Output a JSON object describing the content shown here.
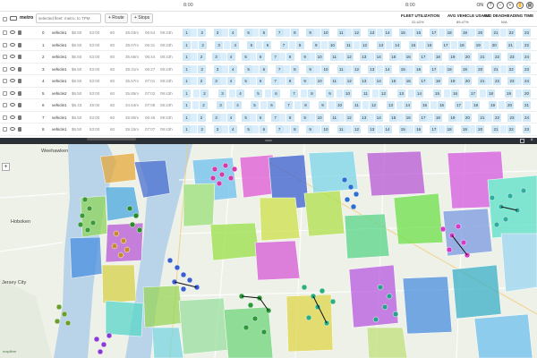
{
  "timeline": {
    "labels": [
      "8:00",
      "8:00",
      "8:00"
    ],
    "on_label": "ON"
  },
  "toolbar": {
    "name": "metro",
    "search_placeholder": "selected fleet: metro, to TPM",
    "route_button": "+ Route",
    "stops_button": "+ Stops",
    "stats": [
      {
        "title": "FLEET UTILIZATION",
        "value": "22.42%"
      },
      {
        "title": "AVG VEHICLE USAGE",
        "value": "89.47%"
      },
      {
        "title": "AVG DEADHEADING TIME",
        "value": "N/A"
      }
    ]
  },
  "rows": [
    {
      "index": "0",
      "vehicle": "vehicle1",
      "rate": "$6.50",
      "start": "53:00",
      "cap": "60",
      "dist": "38.03m",
      "time": "06:54",
      "end": "09:43h",
      "stops": [
        "1",
        "2",
        "3",
        "4",
        "5",
        "6",
        "7",
        "8",
        "9",
        "10",
        "11",
        "12",
        "13",
        "14",
        "15",
        "16",
        "17",
        "18",
        "19",
        "20",
        "21",
        "22",
        "23"
      ]
    },
    {
      "index": "1",
      "vehicle": "vehicle1",
      "rate": "$6.50",
      "start": "53:00",
      "cap": "60",
      "dist": "39.07m",
      "time": "06:31",
      "end": "08:43h",
      "stops": [
        "1",
        "2",
        "3",
        "4",
        "5",
        "6",
        "7",
        "8",
        "9",
        "10",
        "11",
        "12",
        "13",
        "14",
        "15",
        "16",
        "17",
        "18",
        "19",
        "20",
        "21",
        "22"
      ]
    },
    {
      "index": "2",
      "vehicle": "vehicle1",
      "rate": "$6.50",
      "start": "53:00",
      "cap": "60",
      "dist": "35.66m",
      "time": "06:44",
      "end": "08:43h",
      "stops": [
        "1",
        "2",
        "3",
        "4",
        "5",
        "6",
        "7",
        "8",
        "9",
        "10",
        "11",
        "12",
        "13",
        "14",
        "15",
        "16",
        "17",
        "18",
        "19",
        "20",
        "21",
        "22",
        "23",
        "24"
      ]
    },
    {
      "index": "3",
      "vehicle": "vehicle1",
      "rate": "$6.50",
      "start": "53:00",
      "cap": "60",
      "dist": "39.31m",
      "time": "06:27",
      "end": "09:43h",
      "stops": [
        "1",
        "2",
        "3",
        "4",
        "5",
        "6",
        "7",
        "8",
        "9",
        "10",
        "11",
        "12",
        "13",
        "14",
        "15",
        "16",
        "17",
        "18",
        "19",
        "20",
        "21",
        "22",
        "23"
      ]
    },
    {
      "index": "4",
      "vehicle": "vehicle1",
      "rate": "$6.50",
      "start": "53:00",
      "cap": "60",
      "dist": "35.67m",
      "time": "07:01",
      "end": "09:43h",
      "stops": [
        "1",
        "2",
        "3",
        "4",
        "5",
        "6",
        "7",
        "8",
        "9",
        "10",
        "11",
        "12",
        "13",
        "14",
        "15",
        "16",
        "17",
        "18",
        "19",
        "20",
        "21",
        "22",
        "23",
        "24"
      ]
    },
    {
      "index": "5",
      "vehicle": "vehicle2",
      "rate": "$6.50",
      "start": "53:00",
      "cap": "60",
      "dist": "35.85m",
      "time": "07:02",
      "end": "09:43h",
      "stops": [
        "1",
        "2",
        "3",
        "4",
        "5",
        "6",
        "7",
        "8",
        "9",
        "10",
        "11",
        "12",
        "13",
        "14",
        "15",
        "16",
        "17",
        "18",
        "19",
        "20"
      ]
    },
    {
      "index": "6",
      "vehicle": "vehicle1",
      "rate": "$6.43",
      "start": "49:00",
      "cap": "60",
      "dist": "34.54m",
      "time": "07:08",
      "end": "08:43h",
      "stops": [
        "1",
        "2",
        "3",
        "4",
        "5",
        "6",
        "7",
        "8",
        "9",
        "10",
        "11",
        "12",
        "13",
        "14",
        "15",
        "16",
        "17",
        "18",
        "19",
        "20",
        "21"
      ]
    },
    {
      "index": "7",
      "vehicle": "vehicle1",
      "rate": "$6.50",
      "start": "53:00",
      "cap": "60",
      "dist": "38.90m",
      "time": "06:46",
      "end": "09:43h",
      "stops": [
        "1",
        "2",
        "3",
        "4",
        "5",
        "6",
        "7",
        "8",
        "9",
        "10",
        "11",
        "12",
        "13",
        "14",
        "15",
        "16",
        "17",
        "18",
        "19",
        "20",
        "21",
        "22",
        "23",
        "24"
      ]
    },
    {
      "index": "8",
      "vehicle": "vehicle1",
      "rate": "$6.50",
      "start": "53:00",
      "cap": "60",
      "dist": "39.15m",
      "time": "07:07",
      "end": "09:43h",
      "stops": [
        "1",
        "2",
        "3",
        "4",
        "5",
        "6",
        "7",
        "8",
        "9",
        "10",
        "11",
        "12",
        "13",
        "14",
        "15",
        "16",
        "17",
        "18",
        "19",
        "20",
        "21",
        "22",
        "23"
      ]
    }
  ],
  "map": {
    "labels": [
      "Weehawken",
      "Hoboken",
      "Jersey City"
    ],
    "zoom_label": "+",
    "logo": "maplibre"
  },
  "colors": {
    "stop_chip": "#cfe8f7",
    "handle": "#2b2f36",
    "accent": "#2a78c4"
  }
}
